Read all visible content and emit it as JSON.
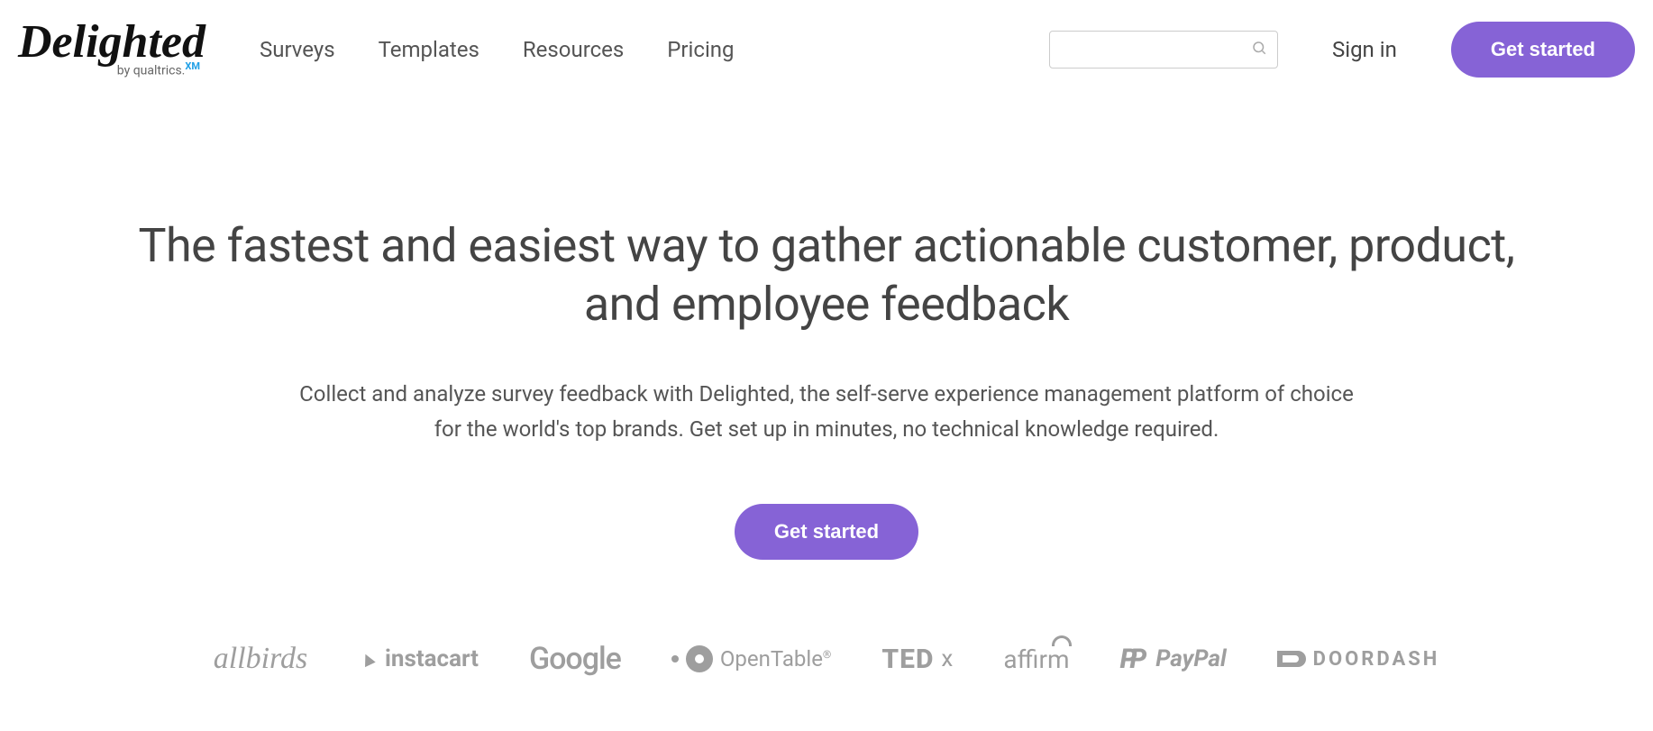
{
  "brand": {
    "name": "Delighted",
    "byline_prefix": "by ",
    "byline_company": "qualtrics.",
    "byline_badge": "XM"
  },
  "nav": {
    "items": [
      "Surveys",
      "Templates",
      "Resources",
      "Pricing"
    ]
  },
  "search": {
    "placeholder": ""
  },
  "header": {
    "signin": "Sign in",
    "cta": "Get started"
  },
  "hero": {
    "headline": "The fastest and easiest way to gather actionable customer, product, and employee feedback",
    "sub": "Collect and analyze survey feedback with Delighted, the self-serve experience management platform of choice for the world's top brands. Get set up in minutes, no technical knowledge required.",
    "cta": "Get started"
  },
  "brands": {
    "allbirds": "allbirds",
    "instacart": "instacart",
    "google": "Google",
    "opentable": "OpenTable",
    "tedx_ted": "TED",
    "tedx_x": "x",
    "affirm": "affirm",
    "paypal": "PayPal",
    "doordash": "DOORDASH"
  },
  "colors": {
    "accent": "#8663d6"
  }
}
